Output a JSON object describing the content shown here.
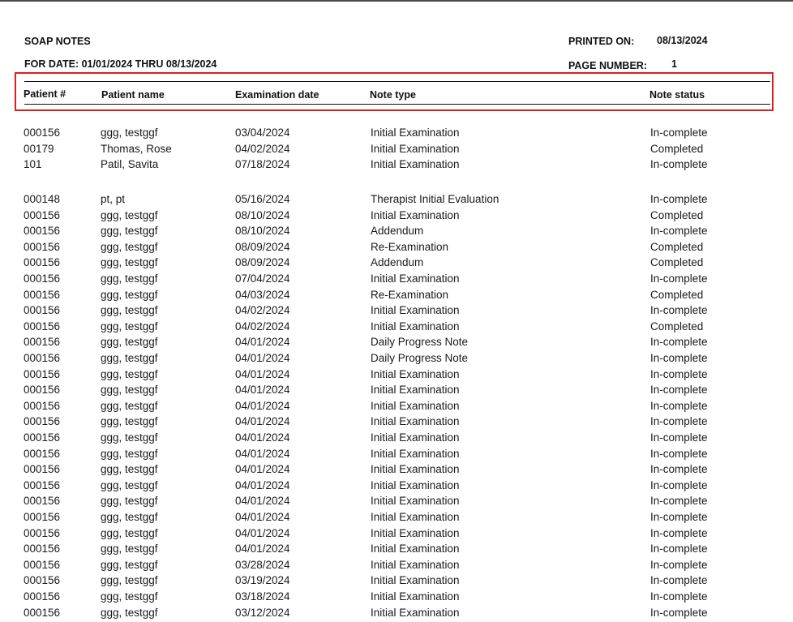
{
  "report": {
    "title": "SOAP NOTES",
    "date_range": "FOR DATE: 01/01/2024 THRU 08/13/2024",
    "printed_on_label": "PRINTED ON:",
    "printed_on_value": "08/13/2024",
    "page_number_label": "PAGE NUMBER:",
    "page_number_value": "1"
  },
  "columns": {
    "patient_num": "Patient #",
    "patient_name": "Patient name",
    "exam_date": "Examination date",
    "note_type": "Note type",
    "note_status": "Note status"
  },
  "groups": [
    {
      "rows": [
        {
          "num": "000156",
          "name": "ggg, testggf",
          "date": "03/04/2024",
          "type": "Initial Examination",
          "status": "In-complete"
        },
        {
          "num": "00179",
          "name": "Thomas, Rose",
          "date": "04/02/2024",
          "type": "Initial Examination",
          "status": "Completed"
        },
        {
          "num": "101",
          "name": "Patil, Savita",
          "date": "07/18/2024",
          "type": "Initial Examination",
          "status": "In-complete"
        }
      ]
    },
    {
      "rows": [
        {
          "num": "000148",
          "name": "pt, pt",
          "date": "05/16/2024",
          "type": "Therapist Initial Evaluation",
          "status": "In-complete"
        },
        {
          "num": "000156",
          "name": "ggg, testggf",
          "date": "08/10/2024",
          "type": "Initial Examination",
          "status": "Completed"
        },
        {
          "num": "000156",
          "name": "ggg, testggf",
          "date": "08/10/2024",
          "type": "Addendum",
          "status": "In-complete"
        },
        {
          "num": "000156",
          "name": "ggg, testggf",
          "date": "08/09/2024",
          "type": "Re-Examination",
          "status": "Completed"
        },
        {
          "num": "000156",
          "name": "ggg, testggf",
          "date": "08/09/2024",
          "type": "Addendum",
          "status": "Completed"
        },
        {
          "num": "000156",
          "name": "ggg, testggf",
          "date": "07/04/2024",
          "type": "Initial Examination",
          "status": "In-complete"
        },
        {
          "num": "000156",
          "name": "ggg, testggf",
          "date": "04/03/2024",
          "type": "Re-Examination",
          "status": "Completed"
        },
        {
          "num": "000156",
          "name": "ggg, testggf",
          "date": "04/02/2024",
          "type": "Initial Examination",
          "status": "In-complete"
        },
        {
          "num": "000156",
          "name": "ggg, testggf",
          "date": "04/02/2024",
          "type": "Initial Examination",
          "status": "Completed"
        },
        {
          "num": "000156",
          "name": "ggg, testggf",
          "date": "04/01/2024",
          "type": "Daily Progress Note",
          "status": "In-complete"
        },
        {
          "num": "000156",
          "name": "ggg, testggf",
          "date": "04/01/2024",
          "type": "Daily Progress Note",
          "status": "In-complete"
        },
        {
          "num": "000156",
          "name": "ggg, testggf",
          "date": "04/01/2024",
          "type": "Initial Examination",
          "status": "In-complete"
        },
        {
          "num": "000156",
          "name": "ggg, testggf",
          "date": "04/01/2024",
          "type": "Initial Examination",
          "status": "In-complete"
        },
        {
          "num": "000156",
          "name": "ggg, testggf",
          "date": "04/01/2024",
          "type": "Initial Examination",
          "status": "In-complete"
        },
        {
          "num": "000156",
          "name": "ggg, testggf",
          "date": "04/01/2024",
          "type": "Initial Examination",
          "status": "In-complete"
        },
        {
          "num": "000156",
          "name": "ggg, testggf",
          "date": "04/01/2024",
          "type": "Initial Examination",
          "status": "In-complete"
        },
        {
          "num": "000156",
          "name": "ggg, testggf",
          "date": "04/01/2024",
          "type": "Initial Examination",
          "status": "In-complete"
        },
        {
          "num": "000156",
          "name": "ggg, testggf",
          "date": "04/01/2024",
          "type": "Initial Examination",
          "status": "In-complete"
        },
        {
          "num": "000156",
          "name": "ggg, testggf",
          "date": "04/01/2024",
          "type": "Initial Examination",
          "status": "In-complete"
        },
        {
          "num": "000156",
          "name": "ggg, testggf",
          "date": "04/01/2024",
          "type": "Initial Examination",
          "status": "In-complete"
        },
        {
          "num": "000156",
          "name": "ggg, testggf",
          "date": "04/01/2024",
          "type": "Initial Examination",
          "status": "In-complete"
        },
        {
          "num": "000156",
          "name": "ggg, testggf",
          "date": "04/01/2024",
          "type": "Initial Examination",
          "status": "In-complete"
        },
        {
          "num": "000156",
          "name": "ggg, testggf",
          "date": "04/01/2024",
          "type": "Initial Examination",
          "status": "In-complete"
        },
        {
          "num": "000156",
          "name": "ggg, testggf",
          "date": "03/28/2024",
          "type": "Initial Examination",
          "status": "In-complete"
        },
        {
          "num": "000156",
          "name": "ggg, testggf",
          "date": "03/19/2024",
          "type": "Initial Examination",
          "status": "In-complete"
        },
        {
          "num": "000156",
          "name": "ggg, testggf",
          "date": "03/18/2024",
          "type": "Initial Examination",
          "status": "In-complete"
        },
        {
          "num": "000156",
          "name": "ggg, testggf",
          "date": "03/12/2024",
          "type": "Initial Examination",
          "status": "In-complete"
        }
      ]
    }
  ],
  "colors": {
    "highlight_border": "#e01b1b",
    "text": "#111111"
  }
}
